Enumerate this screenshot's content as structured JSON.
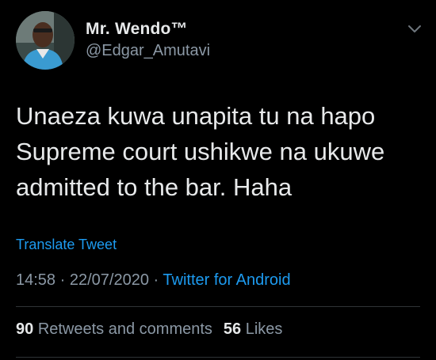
{
  "user": {
    "display_name": "Mr. Wendo™",
    "handle": "@Edgar_Amutavi"
  },
  "tweet": {
    "lines": [
      "Unaeza kuwa unapita tu na hapo",
      "Supreme court ushikwe na ukuwe",
      "admitted to the bar. Haha"
    ],
    "translate_label": "Translate Tweet",
    "time": "14:58",
    "separator": "·",
    "date": "22/07/2020",
    "source": "Twitter for Android"
  },
  "stats": {
    "retweets_count": "90",
    "retweets_label": "Retweets and comments",
    "likes_count": "56",
    "likes_label": "Likes"
  },
  "icons": {
    "menu": "chevron-down-icon",
    "avatar": "profile-photo"
  },
  "colors": {
    "background": "#000000",
    "text": "#e7e9ea",
    "secondary": "#8b98a5",
    "link": "#1d9bf0",
    "divider": "#2f3336"
  }
}
